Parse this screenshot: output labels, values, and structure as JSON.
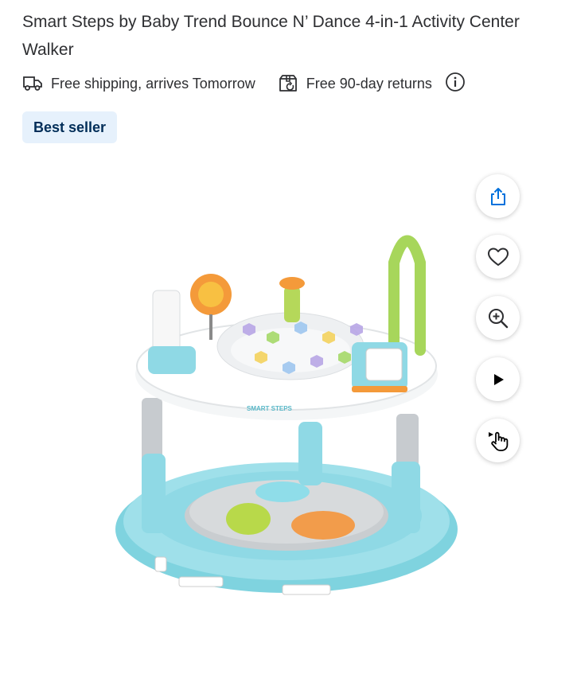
{
  "product": {
    "title": "Smart Steps by Baby Trend Bounce N’ Dance 4-in-1 Activity Center Walker",
    "image_logo_text": "SMART STEPS"
  },
  "fulfillment": {
    "shipping_text": "Free shipping, arrives Tomorrow",
    "returns_text": "Free 90-day returns"
  },
  "badge": {
    "label": "Best seller"
  },
  "actions": [
    {
      "name": "share",
      "icon": "share-icon"
    },
    {
      "name": "favorite",
      "icon": "heart-icon"
    },
    {
      "name": "zoom",
      "icon": "zoom-in-icon"
    },
    {
      "name": "play-video",
      "icon": "play-icon"
    },
    {
      "name": "view-360",
      "icon": "hand-pointer-icon"
    }
  ],
  "colors": {
    "accent_blue": "#0071dc",
    "badge_bg": "#e6f1fc",
    "badge_text": "#002d58",
    "text": "#2e2f32"
  }
}
